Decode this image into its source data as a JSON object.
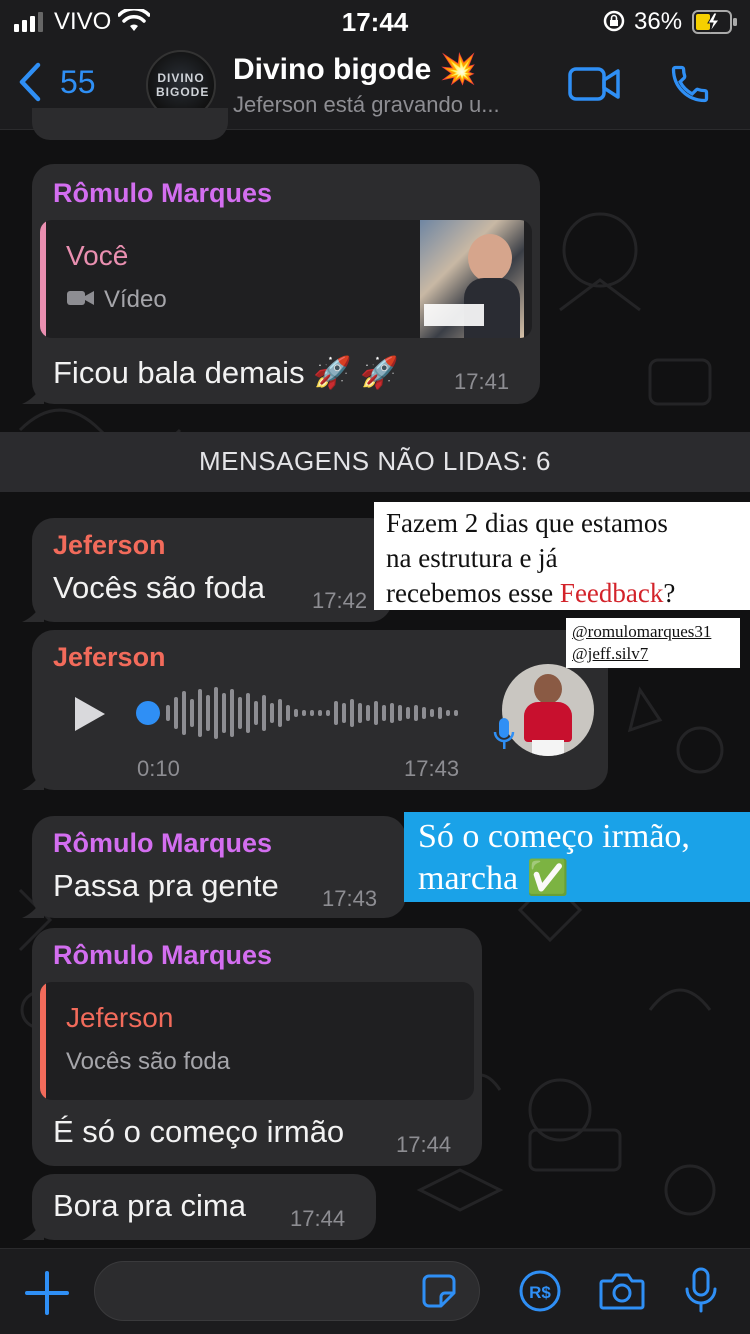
{
  "status_bar": {
    "carrier": "VIVO",
    "time": "17:44",
    "battery": "36%"
  },
  "header": {
    "back_count": "55",
    "avatar_text": "DIVINO BIGODE",
    "title": "Divino bigode 💥",
    "subtitle": "Jeferson está gravando u..."
  },
  "messages": {
    "m1": {
      "sender": "Rômulo Marques",
      "reply_name": "Você",
      "reply_text": "Vídeo",
      "text": "Ficou bala demais 🚀 🚀",
      "time": "17:41"
    },
    "unread": "MENSAGENS NÃO LIDAS: 6",
    "m2": {
      "sender": "Jeferson",
      "text": "Vocês são foda",
      "time": "17:42"
    },
    "m3": {
      "sender": "Jeferson",
      "duration": "0:10",
      "time": "17:43"
    },
    "m4": {
      "sender": "Rômulo Marques",
      "text": "Passa pra gente",
      "time": "17:43"
    },
    "m5": {
      "sender": "Rômulo Marques",
      "reply_name": "Jeferson",
      "reply_text": "Vocês são foda",
      "text": "É só o começo irmão",
      "time": "17:44"
    },
    "m6": {
      "text": "Bora pra cima",
      "time": "17:44"
    }
  },
  "overlays": {
    "white_line1": "Fazem 2 dias que estamos",
    "white_line2": "na estrutura e já",
    "white_line3_pre": "recebemos esse ",
    "white_line3_hl": "Feedback",
    "white_line3_post": "?",
    "tag1": "@romulomarques31",
    "tag2": "@jeff.silv7",
    "blue_line1": "Só o começo irmão,",
    "blue_line2": "marcha ✅"
  },
  "colors": {
    "accent_blue": "#2f8ff5",
    "romulo_name": "#d36ef0",
    "jeferson_name": "#f26b5b",
    "voce_name": "#e98fb0"
  }
}
